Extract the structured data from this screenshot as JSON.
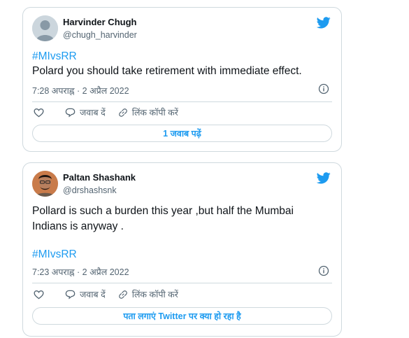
{
  "tweets": [
    {
      "author_name": "Harvinder Chugh",
      "author_handle": "@chugh_harvinder",
      "hashtag": "#MIvsRR",
      "text": "Polard you should take retirement with immediate effect.",
      "timestamp": "7:28 अपराह्न · 2 अप्रैल 2022",
      "reply_label": "जवाब दें",
      "copy_link_label": "लिंक कॉपी करें",
      "bottom_button_label": "1 जवाब पढ़ें"
    },
    {
      "author_name": "Paltan Shashank",
      "author_handle": "@drshashsnk",
      "text_line1": "Pollard is such a burden this year ,but half the Mumbai",
      "text_line2": "Indians is anyway .",
      "hashtag": "#MIvsRR",
      "timestamp": "7:23 अपराह्न · 2 अप्रैल 2022",
      "reply_label": "जवाब दें",
      "copy_link_label": "लिंक कॉपी करें",
      "bottom_button_label": "पता लगाएं Twitter पर क्या हो रहा है"
    }
  ],
  "colors": {
    "accent": "#1d9bf0",
    "secondary_text": "#536471",
    "border": "#cfd9de"
  },
  "icons": [
    "twitter-bird-icon",
    "heart-icon",
    "reply-icon",
    "link-icon",
    "info-icon"
  ]
}
